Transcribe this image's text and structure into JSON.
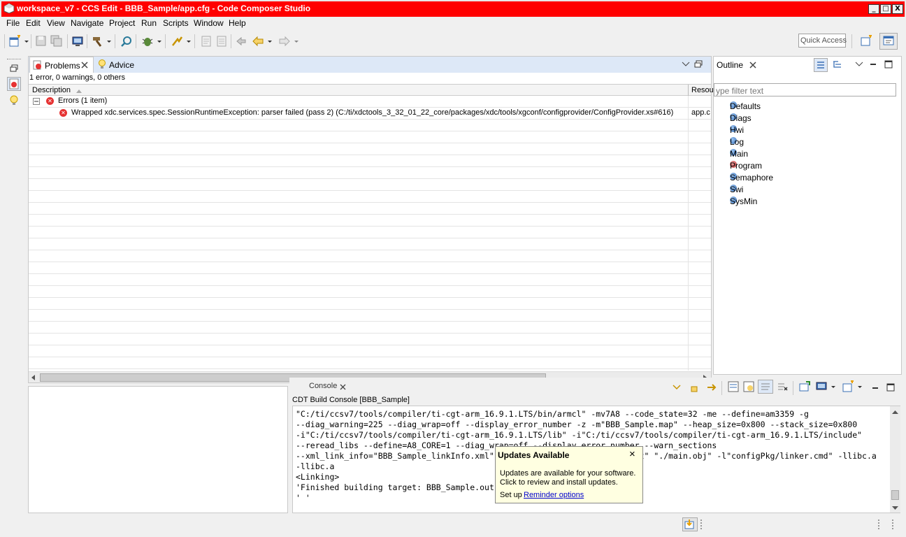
{
  "window": {
    "title": "workspace_v7 - CCS Edit - BBB_Sample/app.cfg - Code Composer Studio",
    "minimize": "_",
    "maximize": "□",
    "close": "X"
  },
  "menu": {
    "items": [
      "File",
      "Edit",
      "View",
      "Navigate",
      "Project",
      "Run",
      "Scripts",
      "Window",
      "Help"
    ]
  },
  "toolbar": {
    "quick_access_placeholder": "Quick Access"
  },
  "problems": {
    "tab_label": "Problems",
    "advice_tab_label": "Advice",
    "summary": "1 error, 0 warnings, 0 others",
    "col_description": "Description",
    "col_resource": "Resou",
    "group_label": "Errors (1 item)",
    "error_message": "Wrapped xdc.services.spec.SessionRuntimeException: parser failed (pass 2) (C:/ti/xdctools_3_32_01_22_core/packages/xdc/tools/xgconf/configprovider/ConfigProvider.xs#616)",
    "error_resource": "app.c"
  },
  "outline": {
    "tab_label": "Outline",
    "filter_placeholder": "ype filter text",
    "items": [
      {
        "label": "Defaults",
        "status": "blue"
      },
      {
        "label": "Diags",
        "status": "blue"
      },
      {
        "label": "Hwi",
        "status": "blue"
      },
      {
        "label": "Log",
        "status": "blue"
      },
      {
        "label": "Main",
        "status": "blue"
      },
      {
        "label": "Program",
        "status": "red"
      },
      {
        "label": "Semaphore",
        "status": "blue"
      },
      {
        "label": "Swi",
        "status": "blue"
      },
      {
        "label": "SysMin",
        "status": "blue"
      }
    ]
  },
  "console": {
    "tab_label": "Console",
    "header": "CDT Build Console [BBB_Sample]",
    "lines": [
      "\"C:/ti/ccsv7/tools/compiler/ti-cgt-arm_16.9.1.LTS/bin/armcl\" -mv7A8 --code_state=32 -me --define=am3359 -g",
      "--diag_warning=225 --diag_wrap=off --display_error_number -z -m\"BBB_Sample.map\" --heap_size=0x800 --stack_size=0x800",
      "-i\"C:/ti/ccsv7/tools/compiler/ti-cgt-arm_16.9.1.LTS/lib\" -i\"C:/ti/ccsv7/tools/compiler/ti-cgt-arm_16.9.1.LTS/include\"",
      "--reread_libs --define=A8_CORE=1 --diag_wrap=off --display_error_number --warn_sections",
      "--xml_link_info=\"BBB_Sample_linkInfo.xml\" --rom_model -o \"BBB_Sample.out\" \"./main.obj\" -l\"configPkg/linker.cmd\" -llibc.a",
      "-llibc.a",
      "<Linking>",
      "'Finished building target: BBB_Sample.out'",
      "' '"
    ]
  },
  "updates_popup": {
    "title": "Updates Available",
    "close": "×",
    "body_line1": "Updates are available for your software.",
    "body_line2": "Click to review and install updates.",
    "setup_prefix": "Set up",
    "link": "Reminder options"
  },
  "colors": {
    "titlebar": "#ff0000",
    "selection_tab": "#dde8f7",
    "error": "#e63232",
    "link": "#0000cc",
    "popup_bg": "#ffffe1"
  }
}
